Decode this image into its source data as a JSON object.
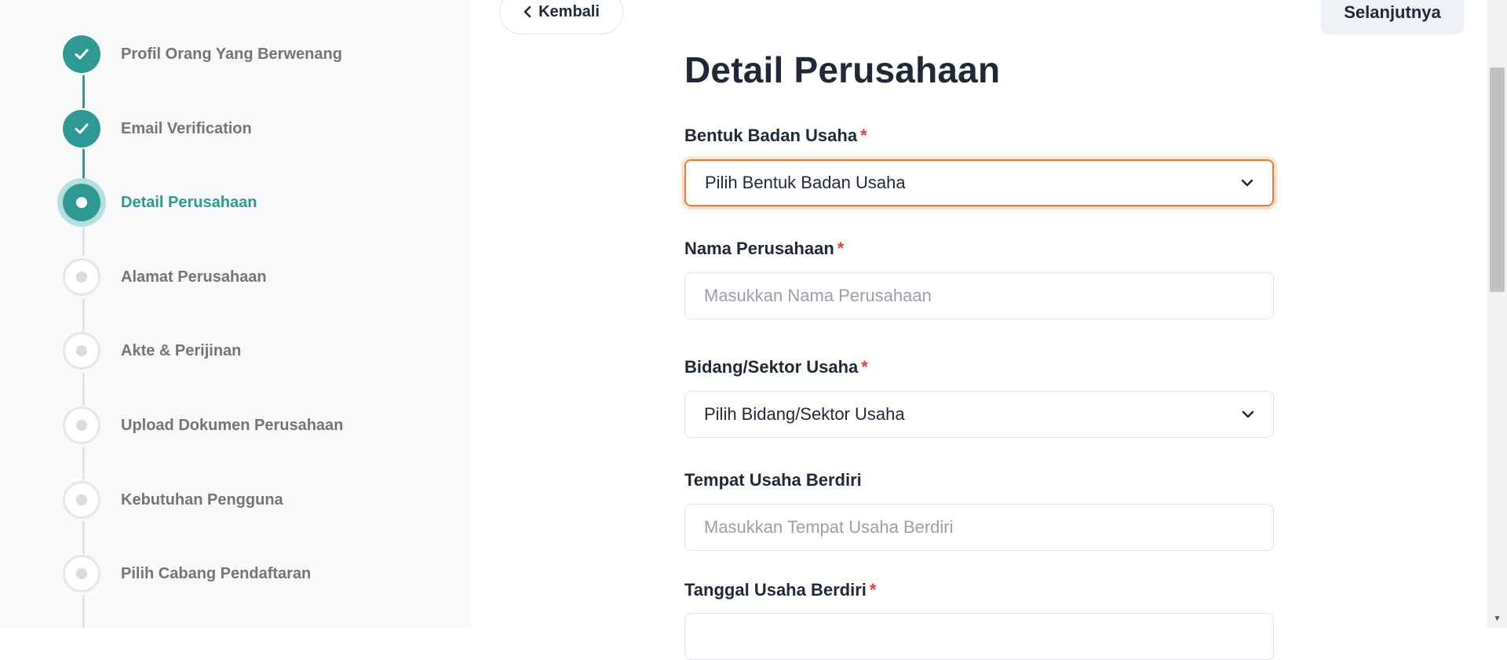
{
  "sidebar": {
    "steps": [
      {
        "label": "Profil Orang Yang Berwenang",
        "status": "done"
      },
      {
        "label": "Email Verification",
        "status": "done"
      },
      {
        "label": "Detail Perusahaan",
        "status": "active"
      },
      {
        "label": "Alamat Perusahaan",
        "status": "pending"
      },
      {
        "label": "Akte & Perijinan",
        "status": "pending"
      },
      {
        "label": "Upload Dokumen Perusahaan",
        "status": "pending"
      },
      {
        "label": "Kebutuhan Pengguna",
        "status": "pending"
      },
      {
        "label": "Pilih Cabang Pendaftaran",
        "status": "pending"
      }
    ]
  },
  "header": {
    "back_label": "Kembali",
    "next_label": "Selanjutnya"
  },
  "form": {
    "title": "Detail Perusahaan",
    "required_mark": "*",
    "fields": [
      {
        "label": "Bentuk Badan Usaha",
        "required": true,
        "type": "select",
        "value": "Pilih Bentuk Badan Usaha"
      },
      {
        "label": "Nama Perusahaan",
        "required": true,
        "type": "text",
        "placeholder": "Masukkan Nama Perusahaan"
      },
      {
        "label": "Bidang/Sektor Usaha",
        "required": true,
        "type": "select",
        "value": "Pilih Bidang/Sektor Usaha"
      },
      {
        "label": "Tempat Usaha Berdiri",
        "required": false,
        "type": "text",
        "placeholder": "Masukkan Tempat Usaha Berdiri"
      },
      {
        "label": "Tanggal Usaha Berdiri",
        "required": true,
        "type": "date"
      }
    ]
  },
  "colors": {
    "accent": "#2e9a94",
    "focus_border": "#f07a2e",
    "required": "#e53e3e"
  },
  "icons": {
    "done": "check-icon",
    "dropdown": "chevron-down-icon",
    "back": "chevron-left-icon"
  }
}
